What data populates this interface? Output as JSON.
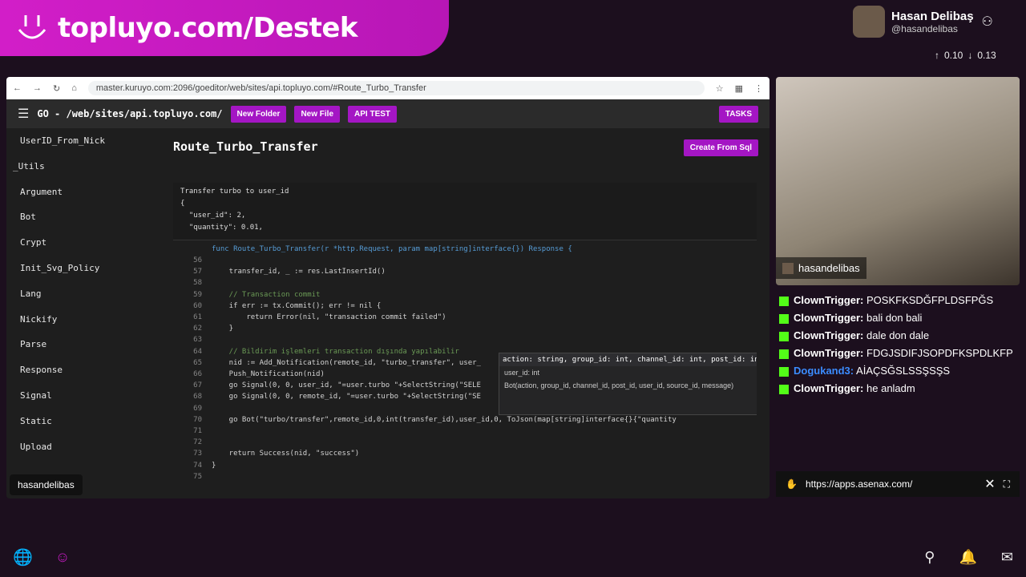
{
  "banner": {
    "text": "topluyo.com/Destek"
  },
  "streamer": {
    "name": "Hasan Delibaş",
    "handle": "@hasandelibas",
    "stat_up": "0.10",
    "stat_down": "0.13"
  },
  "browser": {
    "url": "master.kuruyo.com:2096/goeditor/web/sites/api.topluyo.com/#Route_Turbo_Transfer",
    "path": "GO - /web/sites/api.topluyo.com/",
    "new_folder": "New Folder",
    "new_file": "New File",
    "api_test": "API TEST",
    "tasks": "TASKS"
  },
  "sidebar": {
    "items": [
      "UserID_From_Nick",
      "_Utils",
      "Argument",
      "Bot",
      "Crypt",
      "Init_Svg_Policy",
      "Lang",
      "Nickify",
      "Parse",
      "Response",
      "Signal",
      "Static",
      "Upload"
    ],
    "user": "hasandelibas"
  },
  "main": {
    "title": "Route_Turbo_Transfer",
    "create_from_sql": "Create From Sql",
    "description_lines": [
      "Transfer turbo to user_id",
      "{",
      "  \"user_id\": 2,",
      "  \"quantity\": 0.01,"
    ],
    "signature": "func Route_Turbo_Transfer(r *http.Request, param map[string]interface{}) Response {",
    "lines": [
      {
        "n": "56",
        "t": ""
      },
      {
        "n": "57",
        "t": "    transfer_id, _ := res.LastInsertId()"
      },
      {
        "n": "58",
        "t": ""
      },
      {
        "n": "59",
        "t": "    // Transaction commit"
      },
      {
        "n": "60",
        "t": "    if err := tx.Commit(); err != nil {"
      },
      {
        "n": "61",
        "t": "        return Error(nil, \"transaction commit failed\")"
      },
      {
        "n": "62",
        "t": "    }"
      },
      {
        "n": "63",
        "t": ""
      },
      {
        "n": "64",
        "t": "    // Bildirim işlemleri transaction dışında yapılabilir"
      },
      {
        "n": "65",
        "t": "    nid := Add_Notification(remote_id, \"turbo_transfer\", user_"
      },
      {
        "n": "66",
        "t": "    Push_Notification(nid)"
      },
      {
        "n": "67",
        "t": "    go Signal(0, 0, user_id, \"=user.turbo \"+SelectString(\"SELE"
      },
      {
        "n": "68",
        "t": "    go Signal(0, 0, remote_id, \"=user.turbo \"+SelectString(\"SE"
      },
      {
        "n": "69",
        "t": ""
      },
      {
        "n": "70",
        "t": "    go Bot(\"turbo/transfer\",remote_id,0,int(transfer_id),user_id,0, ToJson(map[string]interface{}{\"quantity"
      },
      {
        "n": "71",
        "t": ""
      },
      {
        "n": "72",
        "t": ""
      },
      {
        "n": "73",
        "t": "    return Success(nid, \"success\")"
      },
      {
        "n": "74",
        "t": "}"
      },
      {
        "n": "75",
        "t": ""
      }
    ],
    "tooltip": {
      "sig": "action: string, group_id: int, channel_id: int, post_id: int,",
      "param": "user_id: int",
      "doc": "Bot(action, group_id, channel_id, post_id, user_id, source_id, message)"
    }
  },
  "cam": {
    "name": "hasandelibas"
  },
  "chat": {
    "messages": [
      {
        "user": "ClownTrigger:",
        "text": "POSKFKSDĞFPLDSFPĞS",
        "blue": false
      },
      {
        "user": "ClownTrigger:",
        "text": "bali don bali",
        "blue": false
      },
      {
        "user": "ClownTrigger:",
        "text": "dale don dale",
        "blue": false
      },
      {
        "user": "ClownTrigger:",
        "text": "FDGJSDIFJSOPDFKSPDLKFP",
        "blue": false
      },
      {
        "user": "Dogukand3:",
        "text": "AİAÇSĞSLSSŞSŞS",
        "blue": true
      },
      {
        "user": "ClownTrigger:",
        "text": "he anladm",
        "blue": false
      }
    ],
    "url": "https://apps.asenax.com/"
  }
}
